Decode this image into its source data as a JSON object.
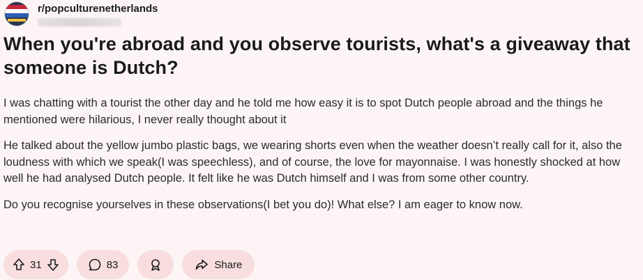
{
  "post": {
    "subreddit": "r/popculturenetherlands",
    "title": "When you're abroad and you observe tourists, what's a giveaway that someone is Dutch?",
    "paragraphs": [
      "I was chatting with a tourist the other day and he told me how easy it is to spot Dutch people abroad and the things he mentioned were hilarious, I never really thought about it",
      "He talked about the yellow jumbo plastic bags, we wearing shorts even when the weather doesn’t really call for it, also the loudness with which we speak(I was speechless), and of course, the love for mayonnaise. I was honestly shocked at how well he had analysed Dutch people. It felt like he was Dutch himself and I was from some other country.",
      "Do you recognise yourselves in these observations(I bet you do)! What else? I am eager to know now."
    ]
  },
  "actions": {
    "upvote_icon": "arrow-up-icon",
    "downvote_icon": "arrow-down-icon",
    "vote_count": "31",
    "comment_icon": "speech-bubble-icon",
    "comment_count": "83",
    "award_icon": "award-ribbon-icon",
    "share_icon": "share-arrow-icon",
    "share_label": "Share"
  },
  "colors": {
    "background": "#fdf5f5",
    "pill": "#f8dede",
    "text": "#1a1a1b"
  }
}
